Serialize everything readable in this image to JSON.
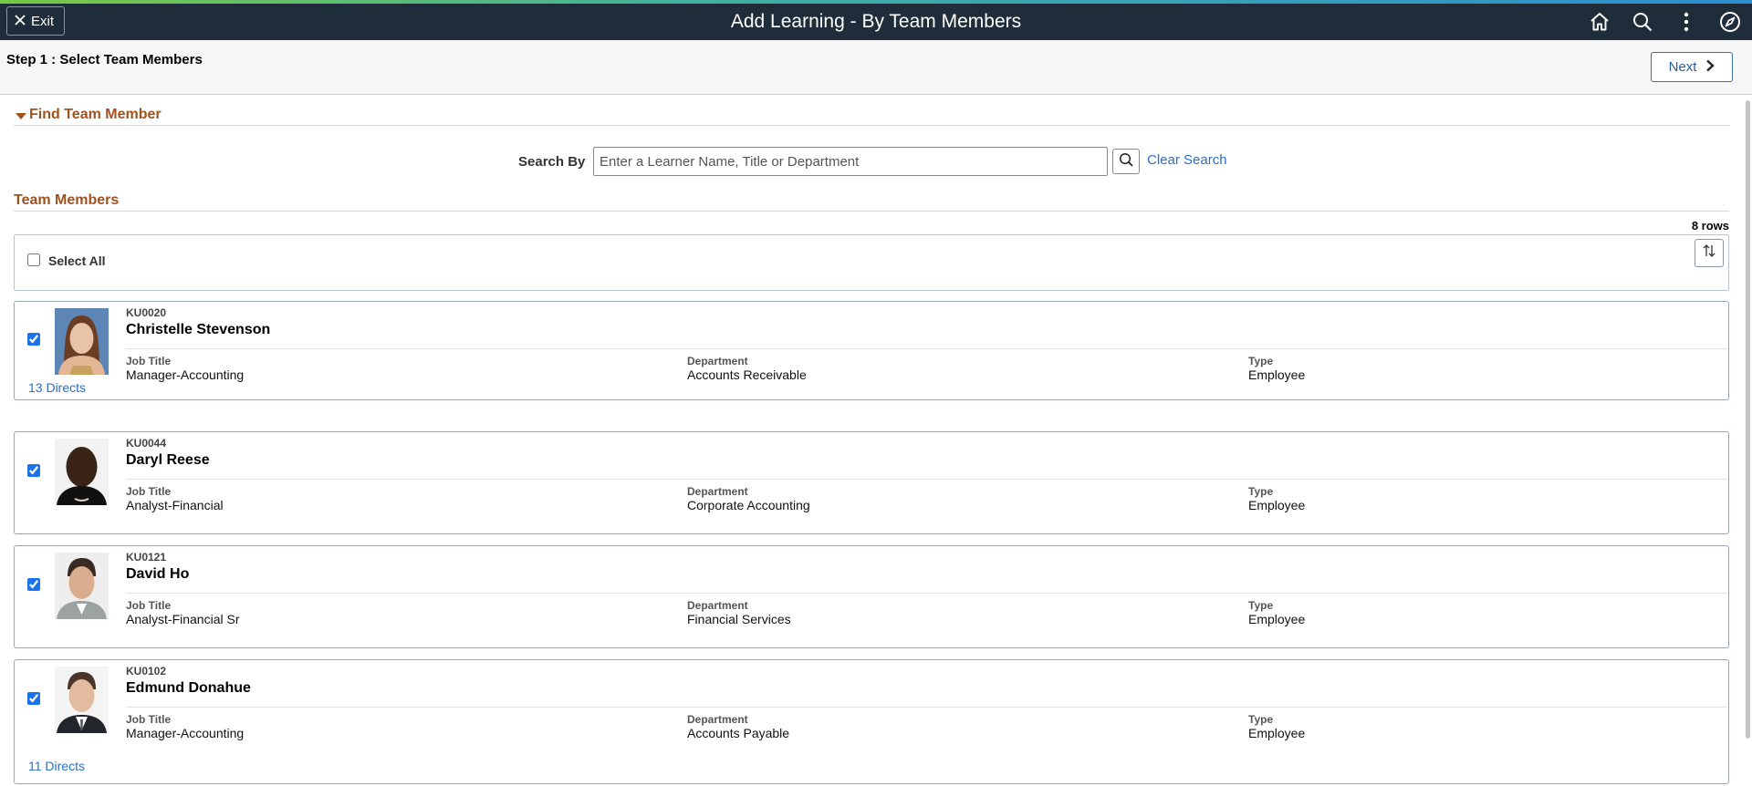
{
  "header": {
    "exit_label": "Exit",
    "title": "Add Learning - By Team Members",
    "icons": [
      "home-icon",
      "search-icon",
      "more-vertical-icon",
      "navbar-compass-icon"
    ]
  },
  "subheader": {
    "step_label": "Step 1 : Select Team Members",
    "next_label": "Next"
  },
  "find": {
    "section_title": "Find Team Member",
    "search_by_label": "Search By",
    "search_placeholder": "Enter a Learner Name, Title or Department",
    "search_value": "",
    "clear_label": "Clear Search"
  },
  "team": {
    "section_title": "Team Members",
    "rows_count": "8 rows",
    "select_all_label": "Select All",
    "select_all_checked": false,
    "labels": {
      "job_title": "Job Title",
      "department": "Department",
      "type": "Type"
    },
    "members": [
      {
        "id": "KU0020",
        "name": "Christelle Stevenson",
        "job_title": "Manager-Accounting",
        "department": "Accounts Receivable",
        "type": "Employee",
        "checked": true,
        "directs": "13 Directs"
      },
      {
        "id": "KU0044",
        "name": "Daryl Reese",
        "job_title": "Analyst-Financial",
        "department": "Corporate Accounting",
        "type": "Employee",
        "checked": true,
        "directs": ""
      },
      {
        "id": "KU0121",
        "name": "David Ho",
        "job_title": "Analyst-Financial Sr",
        "department": "Financial Services",
        "type": "Employee",
        "checked": true,
        "directs": ""
      },
      {
        "id": "KU0102",
        "name": "Edmund Donahue",
        "job_title": "Manager-Accounting",
        "department": "Accounts Payable",
        "type": "Employee",
        "checked": true,
        "directs": "11 Directs"
      }
    ]
  },
  "colors": {
    "topbar": "#1f2d3a",
    "section_title": "#a0521e",
    "link": "#2a6fc9"
  }
}
